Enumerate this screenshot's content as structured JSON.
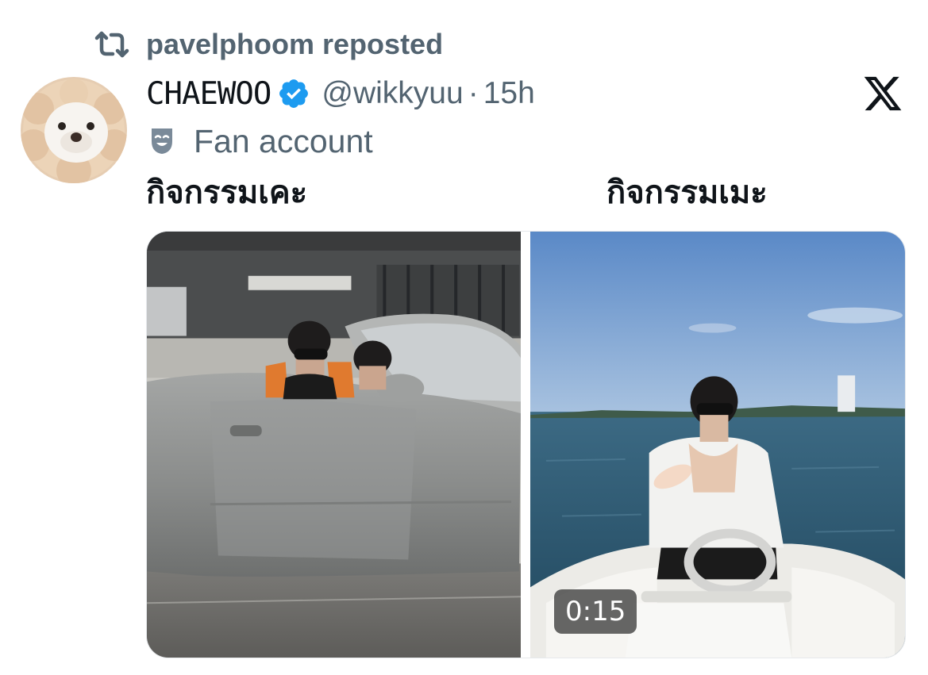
{
  "repost": {
    "text": "pavelphoom reposted",
    "icon": "repost-icon"
  },
  "author": {
    "display_name": "CHAEWOO",
    "handle": "@wikkyuu",
    "separator": "·",
    "time": "15h",
    "verified_icon": "verified-badge-icon",
    "label": "Fan account",
    "label_icon": "theater-mask-icon"
  },
  "platform": {
    "logo": "x-logo-icon"
  },
  "post": {
    "captions": [
      "กิจกรรมเคะ",
      "กิจกรรมเมะ"
    ],
    "media": [
      {
        "type": "image",
        "subject": "two men in grey convertible car"
      },
      {
        "type": "video",
        "duration": "0:15",
        "subject": "man driving speedboat on sea"
      }
    ]
  },
  "colors": {
    "text_primary": "#0f1419",
    "text_secondary": "#536471",
    "verified_blue": "#1d9bf0",
    "duration_badge_bg": "#3c3c3c"
  }
}
